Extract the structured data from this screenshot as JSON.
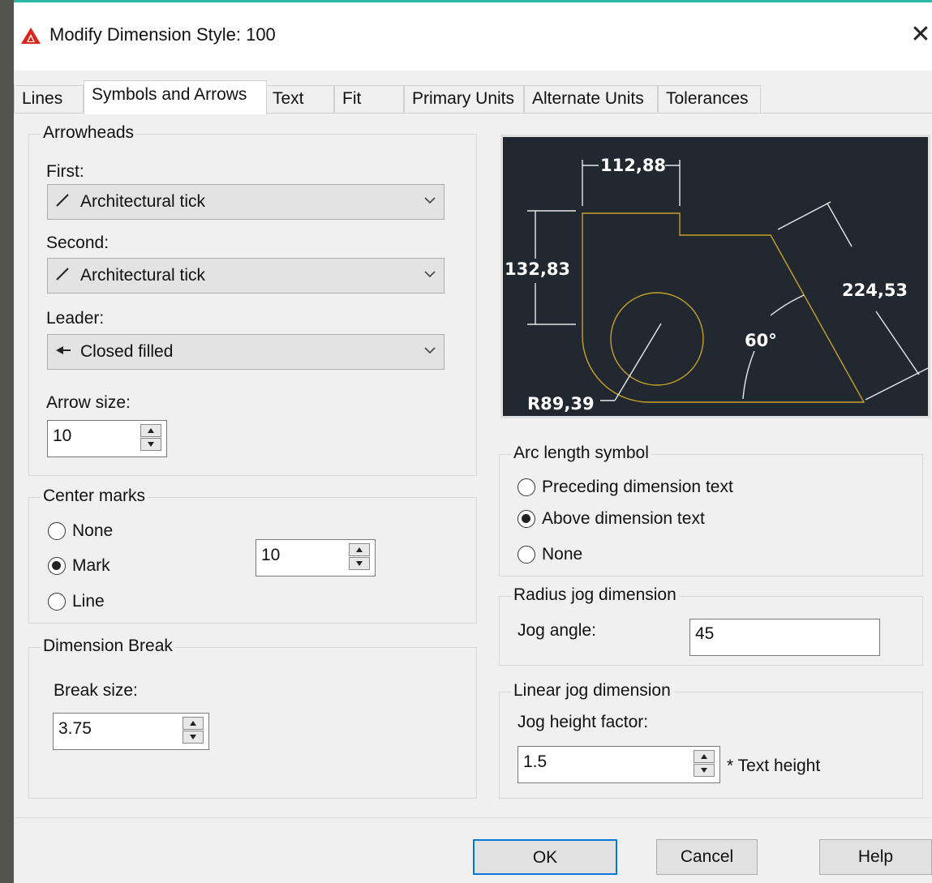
{
  "window": {
    "title": "Modify Dimension Style: 100",
    "close_icon": "close-icon",
    "accent_color": "#2db7a8"
  },
  "tabs": [
    {
      "label": "Lines",
      "active": false
    },
    {
      "label": "Symbols and Arrows",
      "active": true
    },
    {
      "label": "Text",
      "active": false
    },
    {
      "label": "Fit",
      "active": false
    },
    {
      "label": "Primary Units",
      "active": false
    },
    {
      "label": "Alternate Units",
      "active": false
    },
    {
      "label": "Tolerances",
      "active": false
    }
  ],
  "arrowheads": {
    "group_label": "Arrowheads",
    "first_label": "First:",
    "first_value": "Architectural tick",
    "second_label": "Second:",
    "second_value": "Architectural tick",
    "leader_label": "Leader:",
    "leader_value": "Closed filled",
    "arrow_size_label": "Arrow size:",
    "arrow_size_value": "10"
  },
  "center_marks": {
    "group_label": "Center marks",
    "options": [
      "None",
      "Mark",
      "Line"
    ],
    "selected": "Mark",
    "size_value": "10"
  },
  "dimension_break": {
    "group_label": "Dimension Break",
    "break_size_label": "Break size:",
    "break_size_value": "3.75"
  },
  "preview": {
    "dim_top": "112,88",
    "dim_left": "132,83",
    "dim_right": "224,53",
    "angle": "60°",
    "radius": "R89,39",
    "bg_color": "#212830",
    "geometry_color": "#c8a028"
  },
  "arc_length": {
    "group_label": "Arc length symbol",
    "options": [
      "Preceding dimension text",
      "Above dimension text",
      "None"
    ],
    "selected": "Above dimension text"
  },
  "radius_jog": {
    "group_label": "Radius jog dimension",
    "jog_angle_label": "Jog angle:",
    "jog_angle_value": "45"
  },
  "linear_jog": {
    "group_label": "Linear jog dimension",
    "factor_label": "Jog height factor:",
    "factor_value": "1.5",
    "suffix": "* Text height"
  },
  "buttons": {
    "ok": "OK",
    "cancel": "Cancel",
    "help": "Help"
  }
}
